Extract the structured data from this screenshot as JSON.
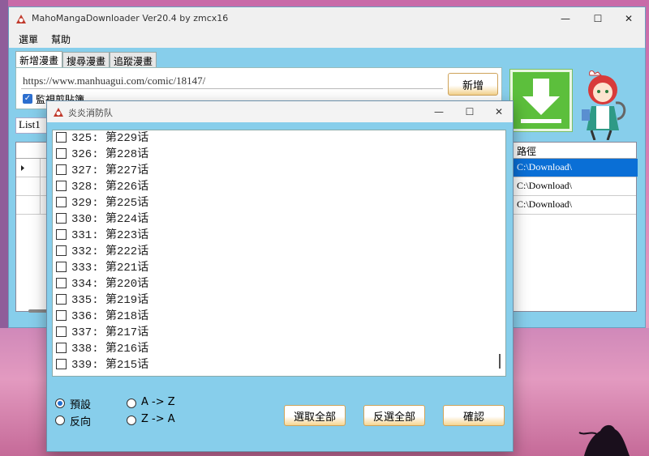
{
  "app": {
    "title": "MahoMangaDownloader Ver20.4 by zmcx16",
    "window_controls": {
      "minimize": "—",
      "maximize": "☐",
      "close": "✕"
    }
  },
  "menu": [
    "選單",
    "幫助"
  ],
  "tabs": [
    {
      "label": "新增漫畫",
      "active": true
    },
    {
      "label": "搜尋漫畫",
      "active": false
    },
    {
      "label": "追蹤漫畫",
      "active": false
    }
  ],
  "add_panel": {
    "url_value": "https://www.manhuagui.com/comic/18147/",
    "add_button": "新增",
    "monitor_clipboard": {
      "label": "監視剪貼簿",
      "checked": true
    }
  },
  "list_selector": "List1",
  "grid": {
    "path_header": "路徑",
    "rows": [
      {
        "path": "C:\\Download\\",
        "selected": true
      },
      {
        "path": "C:\\Download\\",
        "selected": false
      },
      {
        "path": "C:\\Download\\",
        "selected": false
      }
    ]
  },
  "dialog": {
    "title": "炎炎消防队",
    "window_controls": {
      "minimize": "—",
      "maximize": "☐",
      "close": "✕"
    },
    "chapters": [
      "325:  第229话",
      "326:  第228话",
      "327:  第227话",
      "328:  第226话",
      "329:  第225话",
      "330:  第224话",
      "331:  第223话",
      "332:  第222话",
      "333:  第221话",
      "334:  第220话",
      "335:  第219话",
      "336:  第218话",
      "337:  第217话",
      "338:  第216话",
      "339:  第215话"
    ],
    "order_options": [
      {
        "label": "預設",
        "selected": true
      },
      {
        "label": "反向",
        "selected": false
      }
    ],
    "sort_options": [
      {
        "label": "A -> Z",
        "selected": false
      },
      {
        "label": "Z -> A",
        "selected": false
      }
    ],
    "select_all": "選取全部",
    "invert_selection": "反選全部",
    "confirm": "確認"
  },
  "colors": {
    "window_bg": "#87ceeb",
    "accent_blue": "#0a6fd6",
    "download_green": "#5cbf3c",
    "button_gold": "#f7d58f"
  },
  "icons": [
    "app-logo-icon",
    "download-arrow-icon",
    "mascot-image",
    "row-pointer-icon"
  ]
}
